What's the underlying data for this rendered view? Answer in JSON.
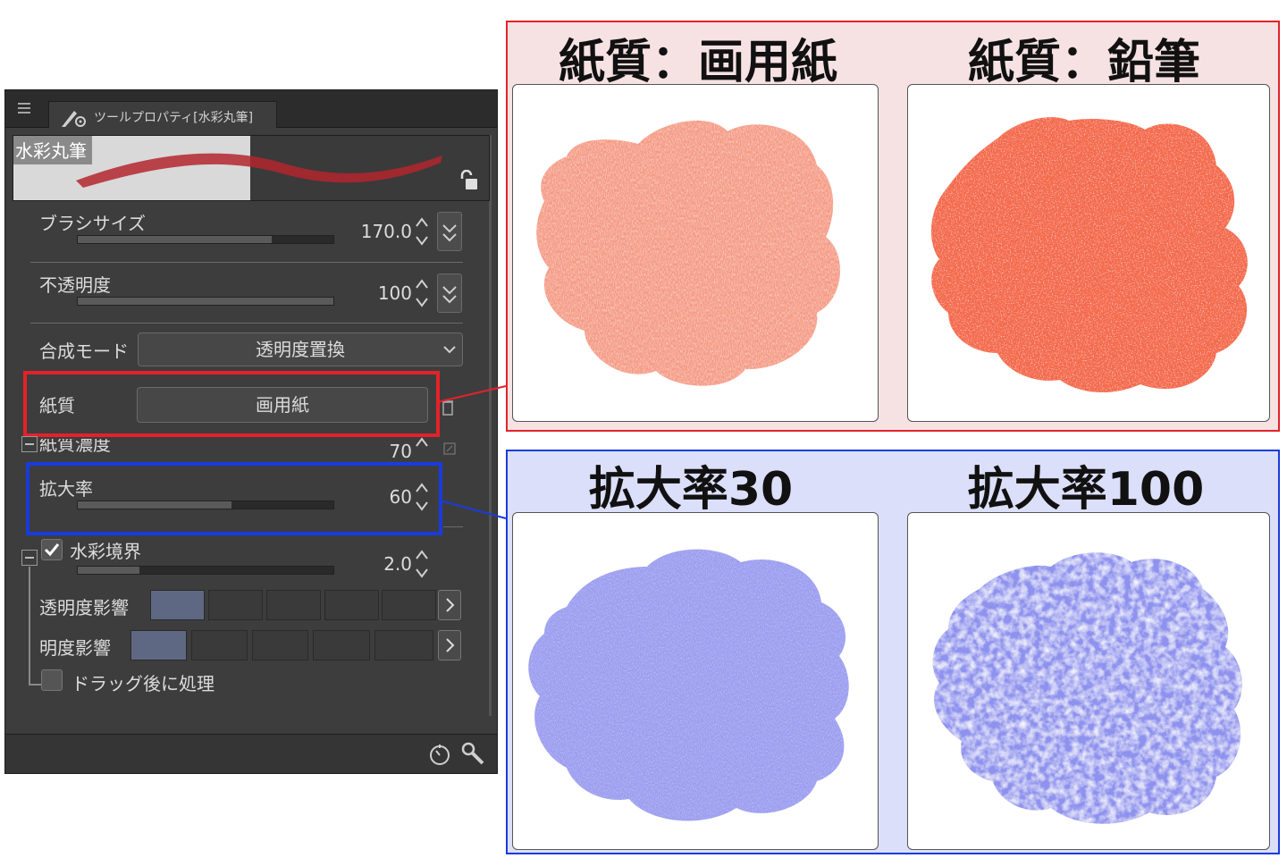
{
  "panel": {
    "tab_label": "ツールプロパティ[水彩丸筆]",
    "preview_name": "水彩丸筆",
    "brush_size": {
      "label": "ブラシサイズ",
      "value": "170.0",
      "fill": 0.76
    },
    "opacity": {
      "label": "不透明度",
      "value": "100",
      "fill": 1.0
    },
    "blend_mode": {
      "label": "合成モード",
      "value": "透明度置換"
    },
    "paper_texture": {
      "label": "紙質",
      "value": "画用紙"
    },
    "texture_density": {
      "label": "紙質濃度",
      "value": "70"
    },
    "scale_ratio": {
      "label": "拡大率",
      "value": "60",
      "fill": 0.6
    },
    "watercolor_edge": {
      "label": "水彩境界",
      "value": "2.0",
      "checked": true,
      "fill": 0.24
    },
    "opacity_effect": {
      "label": "透明度影響",
      "active_swatch": 0
    },
    "brightness_effect": {
      "label": "明度影響",
      "active_swatch": 0
    },
    "process_after_drag": {
      "label": "ドラッグ後に処理",
      "checked": false
    }
  },
  "comparisons": {
    "paper": {
      "left_title": "紙質：画用紙",
      "right_title": "紙質：鉛筆",
      "left_color": "#f59a82",
      "right_color": "#f4694a"
    },
    "scale": {
      "left_title": "拡大率30",
      "right_title": "拡大率100",
      "left_color": "#9a9cf0",
      "right_color": "#8e92ee"
    }
  },
  "colors": {
    "highlight_red": "#e3222a",
    "highlight_blue": "#1a3bdc",
    "panel_bg": "#3d3d3d"
  }
}
